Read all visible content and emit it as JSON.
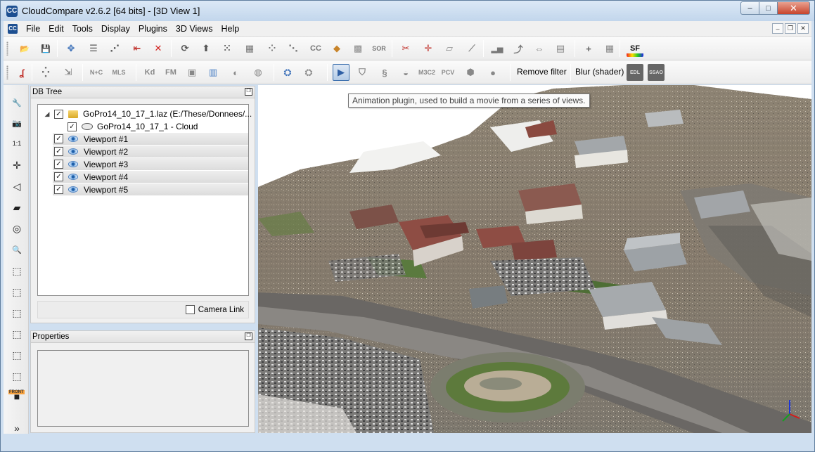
{
  "window": {
    "app_icon": "CC",
    "title": "CloudCompare v2.6.2 [64 bits] - [3D View 1]",
    "controls": {
      "minimize": "–",
      "maximize": "□",
      "close": "✕"
    }
  },
  "menubar": {
    "items": [
      "File",
      "Edit",
      "Tools",
      "Display",
      "Plugins",
      "3D Views",
      "Help"
    ],
    "mdi_controls": {
      "minimize": "–",
      "restore": "❐",
      "close": "✕"
    }
  },
  "toolbar_top": {
    "icons": [
      {
        "name": "open-icon",
        "glyph": "📂",
        "color": "#4a7fc4"
      },
      {
        "name": "save-icon",
        "glyph": "💾",
        "color": "#2e5fa5"
      },
      {
        "name": "clone-icon",
        "glyph": "✥",
        "color": "#3a6fb8"
      },
      {
        "name": "list-icon",
        "glyph": "☰",
        "color": "#555555"
      },
      {
        "name": "graph-icon",
        "glyph": "⋰",
        "color": "#555555"
      },
      {
        "name": "merge-icon",
        "glyph": "⇤",
        "color": "#c0302a"
      },
      {
        "name": "delete-icon",
        "glyph": "✕",
        "color": "#d2231f"
      },
      {
        "name": "sample-icon",
        "glyph": "⟳",
        "color": "#555555"
      },
      {
        "name": "normal-icon",
        "glyph": "⬆",
        "color": "#555555"
      },
      {
        "name": "subsample-icon",
        "glyph": "⁙",
        "color": "#666666"
      },
      {
        "name": "density-icon",
        "glyph": "▦",
        "color": "#777777"
      },
      {
        "name": "noise-icon",
        "glyph": "⁘",
        "color": "#777777"
      },
      {
        "name": "roughness-icon",
        "glyph": "⋱",
        "color": "#777777"
      },
      {
        "name": "cc-icon",
        "glyph": "CC",
        "color": "#777777"
      },
      {
        "name": "bag-icon",
        "glyph": "◆",
        "color": "#c8842a"
      },
      {
        "name": "checker-icon",
        "glyph": "▩",
        "color": "#888888"
      },
      {
        "name": "sor-icon",
        "glyph": "SOR",
        "color": "#777777"
      },
      {
        "name": "scissors-icon",
        "glyph": "✂",
        "color": "#c0302a"
      },
      {
        "name": "translate-icon",
        "glyph": "✛",
        "color": "#c0302a"
      },
      {
        "name": "plane-icon",
        "glyph": "▱",
        "color": "#888888"
      },
      {
        "name": "measure-icon",
        "glyph": "⟋",
        "color": "#888888"
      },
      {
        "name": "histogram-icon",
        "glyph": "▂▅",
        "color": "#777777"
      },
      {
        "name": "curve-icon",
        "glyph": "⤴",
        "color": "#777777"
      },
      {
        "name": "minmax-icon",
        "glyph": "⇔",
        "color": "#777777"
      },
      {
        "name": "trash-icon",
        "glyph": "▤",
        "color": "#888888"
      },
      {
        "name": "add-icon",
        "glyph": "+",
        "color": "#666666"
      },
      {
        "name": "calculator-icon",
        "glyph": "▦",
        "color": "#888888"
      },
      {
        "name": "sf-icon",
        "glyph": "SF",
        "color": "#111111"
      }
    ]
  },
  "toolbar_bottom": {
    "icons": [
      {
        "name": "segment-icon",
        "glyph": "ʆ",
        "color": "#c0302a"
      },
      {
        "name": "cloud-sample-icon",
        "glyph": "⁛",
        "color": "#777777"
      },
      {
        "name": "export-icon",
        "glyph": "⇲",
        "color": "#888888"
      },
      {
        "name": "nc-icon",
        "glyph": "N+C",
        "color": "#888888"
      },
      {
        "name": "mls-icon",
        "glyph": "MLS",
        "color": "#888888"
      },
      {
        "name": "kd-icon",
        "glyph": "Kd",
        "color": "#888888"
      },
      {
        "name": "fm-icon",
        "glyph": "FM",
        "color": "#888888"
      },
      {
        "name": "srf-icon",
        "glyph": "▣",
        "color": "#888888"
      },
      {
        "name": "csv-icon",
        "glyph": "▥",
        "color": "#4a7fc4"
      },
      {
        "name": "sphere-icon",
        "glyph": "◐",
        "color": "#888888"
      },
      {
        "name": "globe-icon",
        "glyph": "◍",
        "color": "#888888"
      },
      {
        "name": "canupo-create-icon",
        "glyph": "⛭",
        "color": "#3a6fb8"
      },
      {
        "name": "canupo-classify-icon",
        "glyph": "⛭",
        "color": "#888888"
      },
      {
        "name": "animation-icon",
        "glyph": "▶",
        "color": "#2e5fa5"
      },
      {
        "name": "shield-icon",
        "glyph": "⛉",
        "color": "#888888"
      },
      {
        "name": "swirl-icon",
        "glyph": "§",
        "color": "#888888"
      },
      {
        "name": "hpr-icon",
        "glyph": "◒",
        "color": "#888888"
      },
      {
        "name": "m3c2-icon",
        "glyph": "M3C2",
        "color": "#888888"
      },
      {
        "name": "pcv-icon",
        "glyph": "PCV",
        "color": "#888888"
      },
      {
        "name": "hexagon-icon",
        "glyph": "⬢",
        "color": "#888888"
      },
      {
        "name": "rod-icon",
        "glyph": "●",
        "color": "#888888"
      }
    ],
    "remove_filter": "Remove filter",
    "blur_shader": "Blur (shader)",
    "edl_icon": "EDL",
    "ssao_icon": "SSAO"
  },
  "left_toolbar": {
    "icons": [
      {
        "name": "wrench-icon",
        "glyph": "🔧"
      },
      {
        "name": "camera-icon",
        "glyph": "📷"
      },
      {
        "name": "zoom-1to1-icon",
        "glyph": "1:1"
      },
      {
        "name": "crosshair-icon",
        "glyph": "✛"
      },
      {
        "name": "pivot-icon",
        "glyph": "◁"
      },
      {
        "name": "perspective-icon",
        "glyph": "▰"
      },
      {
        "name": "light-icon",
        "glyph": "◎"
      },
      {
        "name": "magnifier-icon",
        "glyph": "🔍"
      },
      {
        "name": "view-top-icon",
        "glyph": "⬚"
      },
      {
        "name": "view-front-icon",
        "glyph": "⬚"
      },
      {
        "name": "view-left-icon",
        "glyph": "⬚"
      },
      {
        "name": "view-back-icon",
        "glyph": "⬚"
      },
      {
        "name": "view-right-icon",
        "glyph": "⬚"
      },
      {
        "name": "view-bottom-icon",
        "glyph": "⬚"
      },
      {
        "name": "view-iso-icon",
        "glyph": "■"
      },
      {
        "name": "more-icon",
        "glyph": "»"
      }
    ],
    "front_label": "FRONT"
  },
  "db_tree": {
    "title": "DB Tree",
    "root_label": "GoPro14_10_17_1.laz (E:/These/Donnees/...",
    "cloud_label": "GoPro14_10_17_1 - Cloud",
    "viewports": [
      "Viewport #1",
      "Viewport #2",
      "Viewport #3",
      "Viewport #4",
      "Viewport #5"
    ],
    "check": "✓",
    "expander": "◢",
    "camera_link": "Camera Link"
  },
  "properties": {
    "title": "Properties"
  },
  "tooltip": "Animation plugin, used to build a movie from a series of views.",
  "colors": {
    "terrain": "#8a8070",
    "road": "#6e6a66",
    "grass": "#5a7a3e",
    "roof_red": "#8e4d44",
    "roof_gray": "#9da2a6"
  }
}
